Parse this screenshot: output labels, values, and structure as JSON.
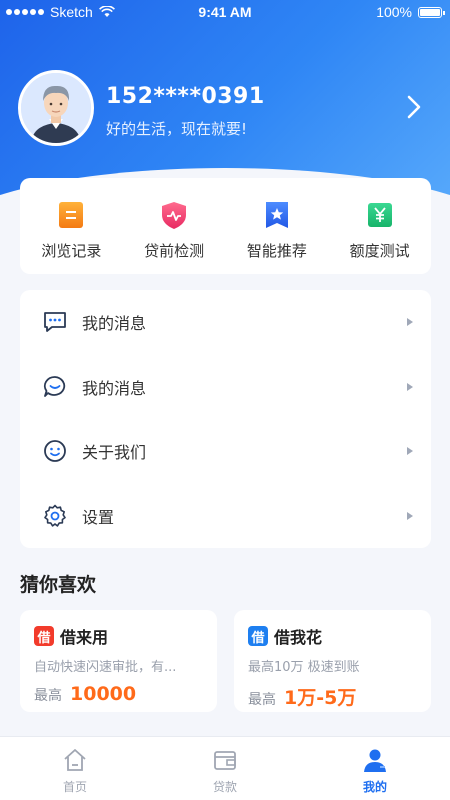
{
  "status_bar": {
    "carrier": "Sketch",
    "time": "9:41 AM",
    "battery": "100%"
  },
  "profile": {
    "phone": "152****0391",
    "slogan": "好的生活，现在就要!"
  },
  "quick_actions": [
    {
      "label": "浏览记录",
      "icon": "history-icon",
      "color": "#f7931e"
    },
    {
      "label": "贷前检测",
      "icon": "shield-pulse-icon",
      "color": "#f0417a"
    },
    {
      "label": "智能推荐",
      "icon": "star-bookmark-icon",
      "color": "#2f6ff2"
    },
    {
      "label": "额度测试",
      "icon": "yen-icon",
      "color": "#23c17c"
    }
  ],
  "menu": [
    {
      "label": "我的消息",
      "icon": "message-icon"
    },
    {
      "label": "我的消息",
      "icon": "chat-smile-icon"
    },
    {
      "label": "关于我们",
      "icon": "smiley-icon"
    },
    {
      "label": "设置",
      "icon": "gear-icon"
    }
  ],
  "recommend": {
    "title": "猜你喜欢",
    "cards": [
      {
        "logo": "借",
        "logo_color": "#f23b2b",
        "name": "借来用",
        "desc": "自动快速闪速审批，有...",
        "amount_label": "最高",
        "amount": "10000"
      },
      {
        "logo": "借",
        "logo_color": "#1e7ff0",
        "name": "借我花",
        "desc": "最高10万 极速到账",
        "amount_label": "最高",
        "amount": "1万-5万"
      }
    ]
  },
  "tabbar": {
    "items": [
      {
        "label": "首页",
        "icon": "home-icon",
        "active": false
      },
      {
        "label": "贷款",
        "icon": "wallet-icon",
        "active": false
      },
      {
        "label": "我的",
        "icon": "user-icon",
        "active": true
      }
    ]
  },
  "colors": {
    "brand": "#1f6ff0",
    "accent_orange": "#ff6a1a",
    "background": "#f4f6fb"
  }
}
